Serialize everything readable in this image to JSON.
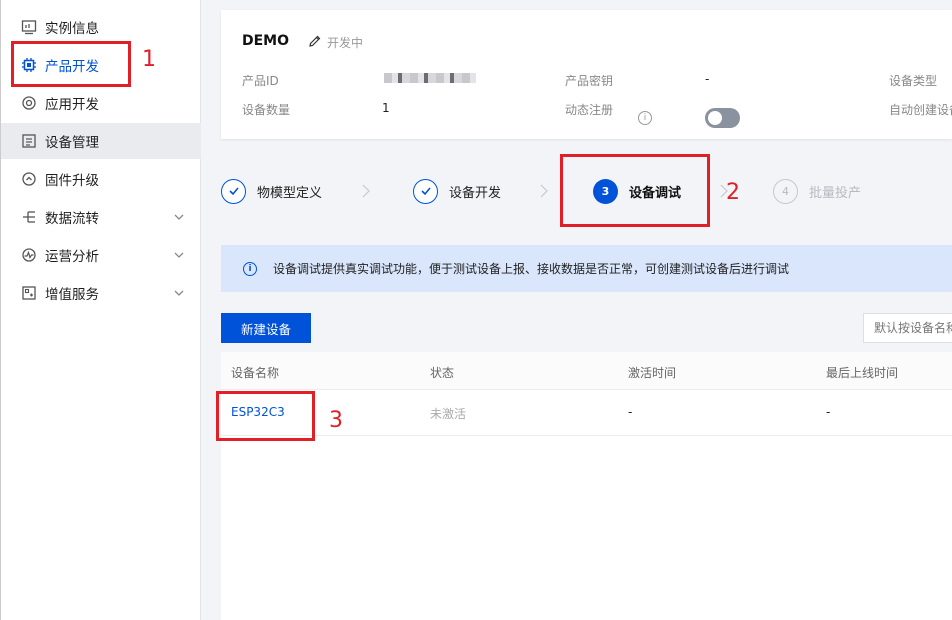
{
  "sidebar": {
    "items": [
      {
        "label": "实例信息",
        "icon": "monitor-icon"
      },
      {
        "label": "产品开发",
        "icon": "chip-icon",
        "active": true
      },
      {
        "label": "应用开发",
        "icon": "target-icon"
      },
      {
        "label": "设备管理",
        "icon": "device-list-icon",
        "selected": true
      },
      {
        "label": "固件升级",
        "icon": "upgrade-icon"
      },
      {
        "label": "数据流转",
        "icon": "flow-icon",
        "expandable": true
      },
      {
        "label": "运营分析",
        "icon": "analytics-icon",
        "expandable": true
      },
      {
        "label": "增值服务",
        "icon": "value-service-icon",
        "expandable": true
      }
    ]
  },
  "product": {
    "name": "DEMO",
    "status": "开发中",
    "fields": {
      "product_id_label": "产品ID",
      "product_secret_label": "产品密钥",
      "product_secret_value": "-",
      "device_type_label": "设备类型",
      "device_count_label": "设备数量",
      "device_count_value": "1",
      "dynamic_register_label": "动态注册",
      "auto_create_label": "自动创建设备"
    }
  },
  "steps": [
    {
      "label": "物模型定义",
      "state": "done"
    },
    {
      "label": "设备开发",
      "state": "done"
    },
    {
      "number": "3",
      "label": "设备调试",
      "state": "current"
    },
    {
      "number": "4",
      "label": "批量投产",
      "state": "pending"
    }
  ],
  "notice": {
    "text": "设备调试提供真实调试功能，便于测试设备上报、接收数据是否正常，可创建测试设备后进行调试"
  },
  "toolbar": {
    "new_device_label": "新建设备",
    "search_placeholder": "默认按设备名称"
  },
  "table": {
    "headers": [
      "设备名称",
      "状态",
      "激活时间",
      "最后上线时间"
    ],
    "rows": [
      {
        "name": "ESP32C3",
        "status": "未激活",
        "activated": "-",
        "last_online": "-"
      }
    ]
  },
  "annotations": [
    "1",
    "2",
    "3"
  ],
  "colors": {
    "accent": "#0052d9",
    "annotation": "#e01f26",
    "notice_bg": "#d9e6fb"
  }
}
